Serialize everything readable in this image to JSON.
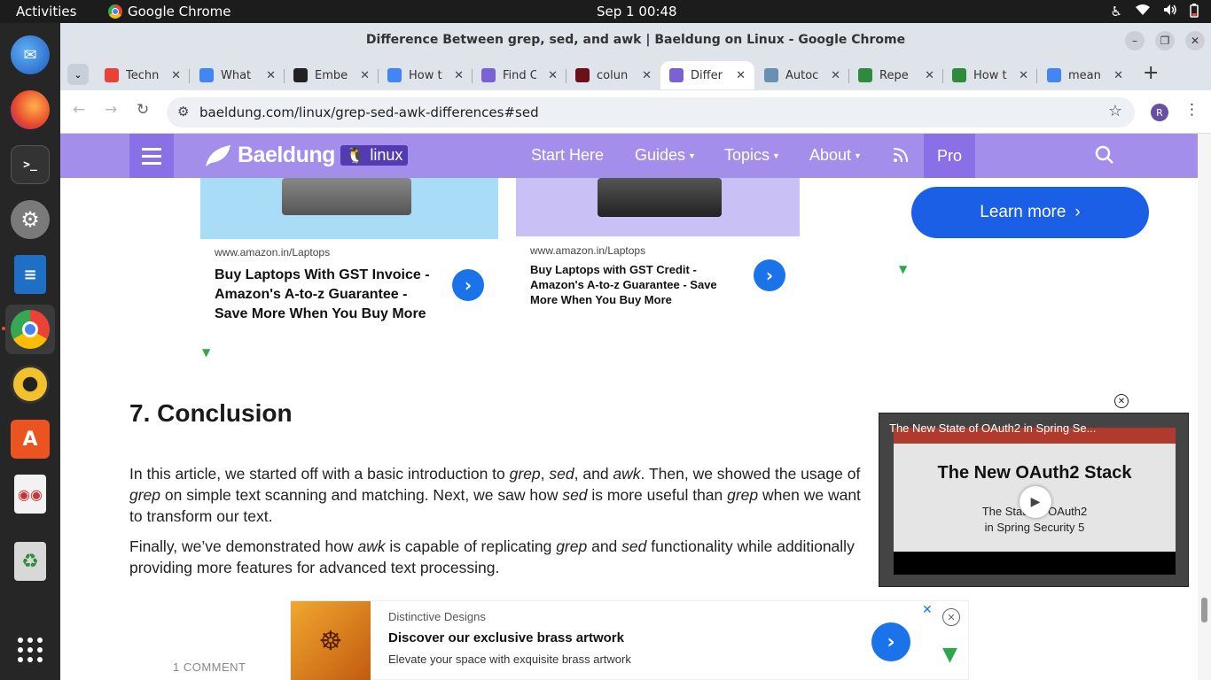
{
  "topbar": {
    "activities": "Activities",
    "app_name": "Google Chrome",
    "clock": "Sep 1  00:48",
    "tray_icons": [
      "accessibility-icon",
      "wifi-icon",
      "volume-icon",
      "battery-icon"
    ]
  },
  "dock": {
    "items": [
      "thunderbird",
      "firefox",
      "terminal",
      "settings",
      "writer",
      "chrome",
      "rhythmbox",
      "app-center",
      "document-viewer",
      "trash",
      "show-apps"
    ]
  },
  "window": {
    "title": "Difference Between grep, sed, and awk | Baeldung on Linux - Google Chrome"
  },
  "tabs": [
    {
      "label": "Techn",
      "icon": "gmail-icon",
      "color": "#ea4335"
    },
    {
      "label": "What",
      "icon": "docs-icon",
      "color": "#4285f4"
    },
    {
      "label": "Embe",
      "icon": "notion-icon",
      "color": "#222222"
    },
    {
      "label": "How t",
      "icon": "google-icon",
      "color": "#4285f4"
    },
    {
      "label": "Find C",
      "icon": "baeldung-icon",
      "color": "#7b61d6"
    },
    {
      "label": "colun",
      "icon": "codecademy-icon",
      "color": "#6b0f1a"
    },
    {
      "label": "Differ",
      "icon": "baeldung-icon",
      "color": "#7b61d6",
      "active": true
    },
    {
      "label": "Autoc",
      "icon": "settings-icon",
      "color": "#6a8fb0"
    },
    {
      "label": "Repe",
      "icon": "sheets-icon",
      "color": "#2e8b3d"
    },
    {
      "label": "How t",
      "icon": "tutorial-icon",
      "color": "#2e8b3d"
    },
    {
      "label": "mean",
      "icon": "google-icon",
      "color": "#4285f4"
    }
  ],
  "address_bar": {
    "url": "baeldung.com/linux/grep-sed-awk-differences#sed",
    "profile_initial": "R"
  },
  "site_nav": {
    "logo_name": "Baeldung",
    "logo_badge": "linux",
    "links": [
      "Start Here",
      "Guides",
      "Topics",
      "About"
    ],
    "pro": "Pro"
  },
  "ads": {
    "ad1": {
      "domain": "www.amazon.in/Laptops",
      "title": "Buy Laptops With GST Invoice - Amazon's A-to-z Guarantee - Save More When You Buy More"
    },
    "ad2": {
      "domain": "www.amazon.in/Laptops",
      "title": "Buy Laptops with GST Credit - Amazon's A-to-z Guarantee - Save More When You Buy More"
    },
    "learn_more": "Learn more"
  },
  "article": {
    "heading": "7. Conclusion",
    "para1": {
      "t1": "In this article, we started off with a basic introduction to ",
      "e1": "grep",
      "t2": ", ",
      "e2": "sed",
      "t3": ", and ",
      "e3": "awk",
      "t4": ". Then, we showed the usage of ",
      "e4": "grep",
      "t5": " on simple text scanning and matching. Next, we saw how ",
      "e5": "sed",
      "t6": " is more useful than ",
      "e6": "grep",
      "t7": " when we want to transform our text."
    },
    "para2": {
      "t1": "Finally, we’ve demonstrated how ",
      "e1": "awk",
      "t2": " is capable of replicating ",
      "e2": "grep",
      "t3": " and ",
      "e3": "sed",
      "t4": " functionality while additionally providing more features for advanced text processing."
    },
    "comments": "1 COMMENT"
  },
  "video": {
    "title": "The New State of OAuth2 in Spring Se...",
    "headline": "The New OAuth2 Stack",
    "subtitle_line1": "The State of OAuth2",
    "subtitle_line2": "in Spring Security 5"
  },
  "bottom_ad": {
    "advertiser": "Distinctive Designs",
    "headline": "Discover our exclusive brass artwork",
    "description": "Elevate your space with exquisite brass artwork"
  }
}
